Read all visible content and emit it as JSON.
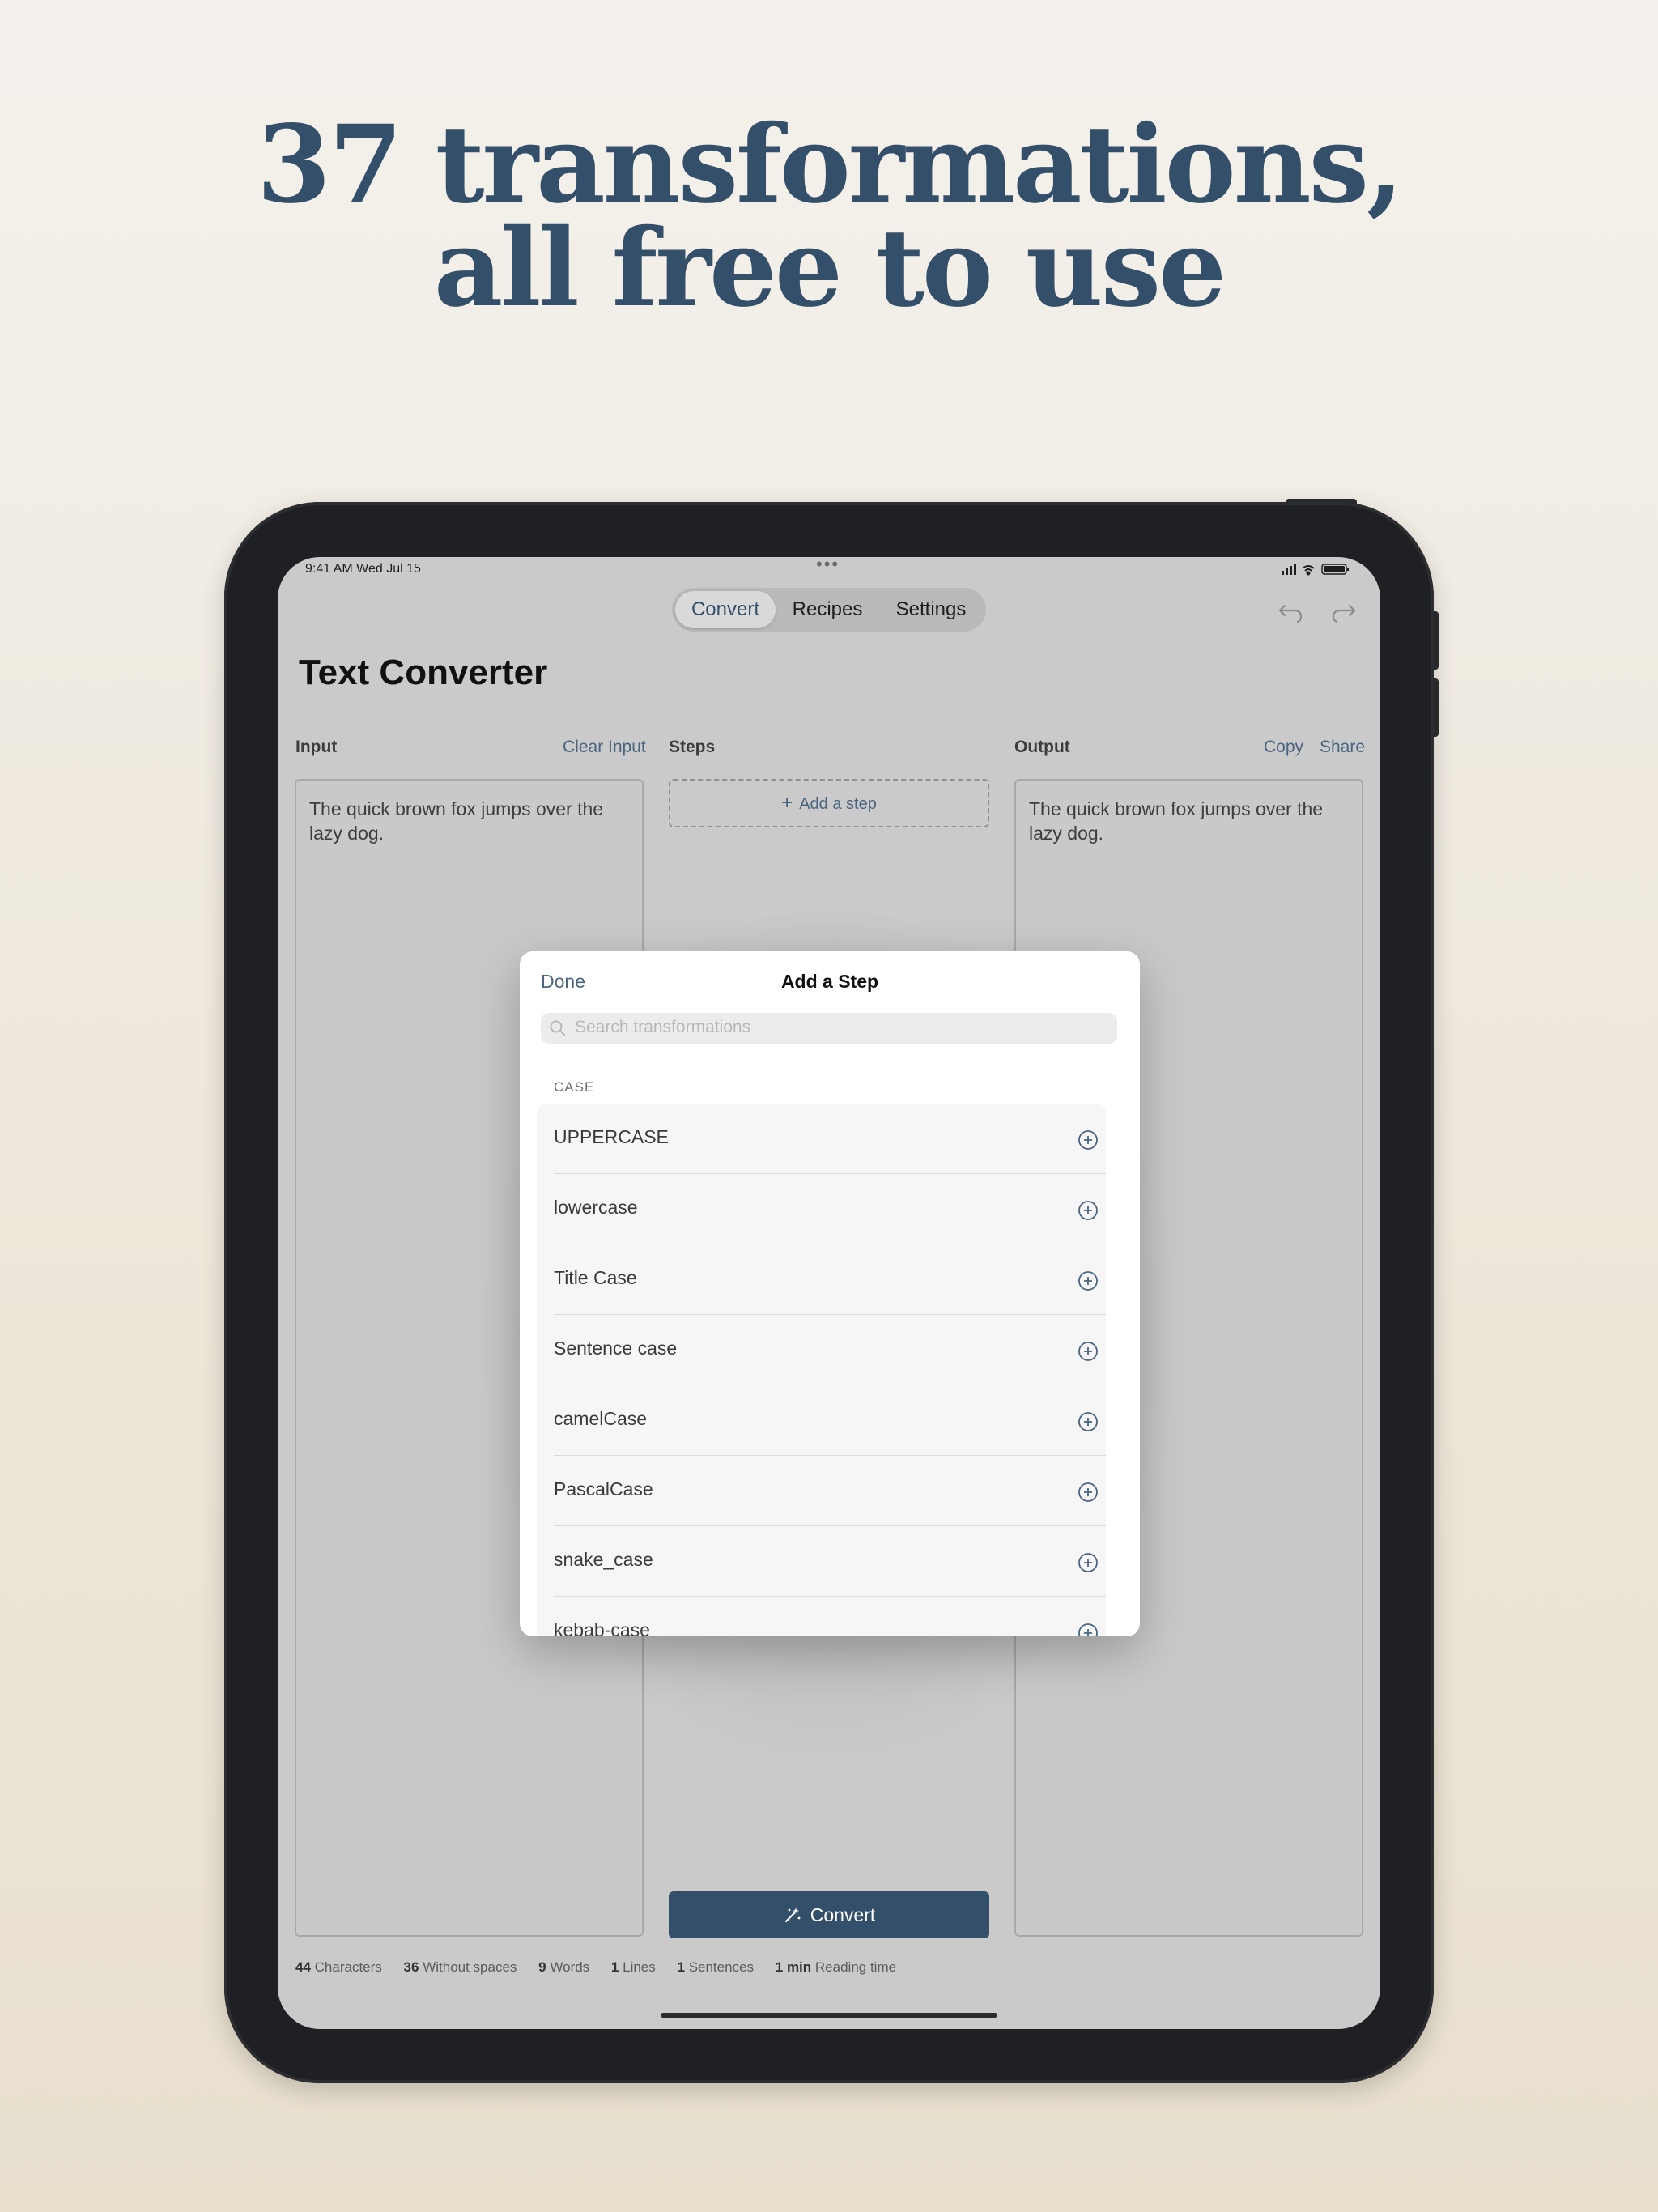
{
  "headline": {
    "line1": "37 transformations,",
    "line2": "all free to use"
  },
  "status_bar": {
    "time": "9:41 AM   Wed Jul 15"
  },
  "nav": {
    "tabs": [
      "Convert",
      "Recipes",
      "Settings"
    ],
    "active_tab": "Convert"
  },
  "app_title": "Text Converter",
  "input": {
    "label": "Input",
    "clear_label": "Clear Input",
    "text": "The quick brown fox jumps over the lazy dog."
  },
  "steps": {
    "label": "Steps",
    "add_label": "Add a step",
    "convert_label": "Convert"
  },
  "output": {
    "label": "Output",
    "copy_label": "Copy",
    "share_label": "Share",
    "text": "The quick brown fox jumps over the lazy dog."
  },
  "stats": {
    "characters": {
      "value": "44",
      "label": "Characters"
    },
    "without_spaces": {
      "value": "36",
      "label": "Without spaces"
    },
    "words": {
      "value": "9",
      "label": "Words"
    },
    "lines": {
      "value": "1",
      "label": "Lines"
    },
    "sentences": {
      "value": "1",
      "label": "Sentences"
    },
    "reading_time": {
      "value": "1 min",
      "label": "Reading time"
    }
  },
  "modal": {
    "done_label": "Done",
    "title": "Add a Step",
    "search_placeholder": "Search transformations",
    "section_title": "CASE",
    "items": [
      "UPPERCASE",
      "lowercase",
      "Title Case",
      "Sentence case",
      "camelCase",
      "PascalCase",
      "snake_case",
      "kebab-case"
    ]
  },
  "colors": {
    "accent": "#344f69",
    "link": "#4a6480",
    "screen_bg": "#cacaca",
    "page_bg": "#f4f1ec"
  },
  "icons": [
    "undo-icon",
    "redo-icon",
    "plus-icon",
    "magic-wand-icon",
    "search-icon",
    "plus-circle-icon",
    "signal-icon",
    "wifi-icon",
    "battery-icon"
  ]
}
